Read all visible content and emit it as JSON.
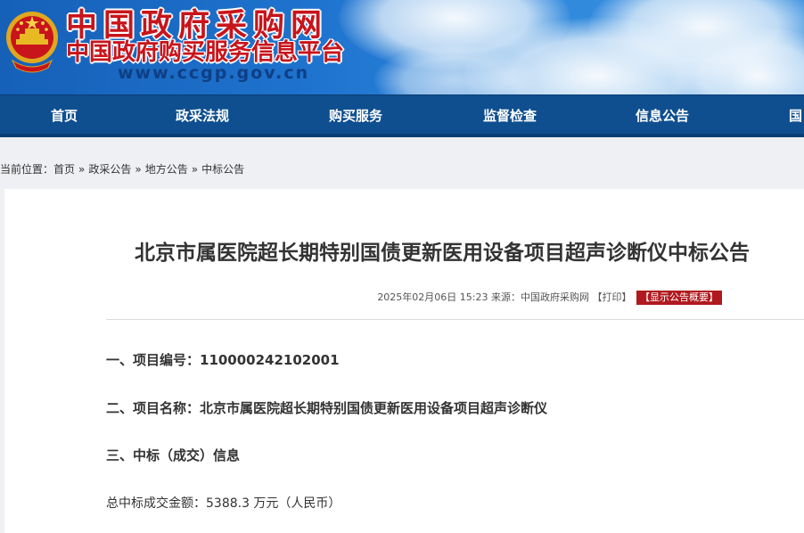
{
  "header": {
    "site_name": "中国政府采购网",
    "site_subtitle": "中国政府购买服务信息平台",
    "site_url": "www.ccgp.gov.cn",
    "emblem_icon": "national-emblem-icon",
    "brand_red": "#c8141b",
    "brand_blue": "#0f4f90"
  },
  "nav": {
    "items": [
      "首页",
      "政采法规",
      "购买服务",
      "监督检查",
      "信息公告",
      "国"
    ]
  },
  "breadcrumb": {
    "prefix": "当前位置：",
    "items": [
      "首页",
      "政采公告",
      "地方公告",
      "中标公告"
    ],
    "separator": "»"
  },
  "article": {
    "title": "北京市属医院超长期特别国债更新医用设备项目超声诊断仪中标公告",
    "meta": {
      "datetime": "2025年02月06日 15:23",
      "source_label": "来源：",
      "source": "中国政府采购网",
      "print": "【打印】",
      "summary_badge": "【显示公告概要】"
    },
    "sections": {
      "project_no": "一、项目编号：110000242102001",
      "project_name": "二、项目名称：北京市属医院超长期特别国债更新医用设备项目超声诊断仪",
      "award_info": "三、中标（成交）信息",
      "total_amount": "总中标成交金额：5388.3 万元（人民币）"
    }
  }
}
